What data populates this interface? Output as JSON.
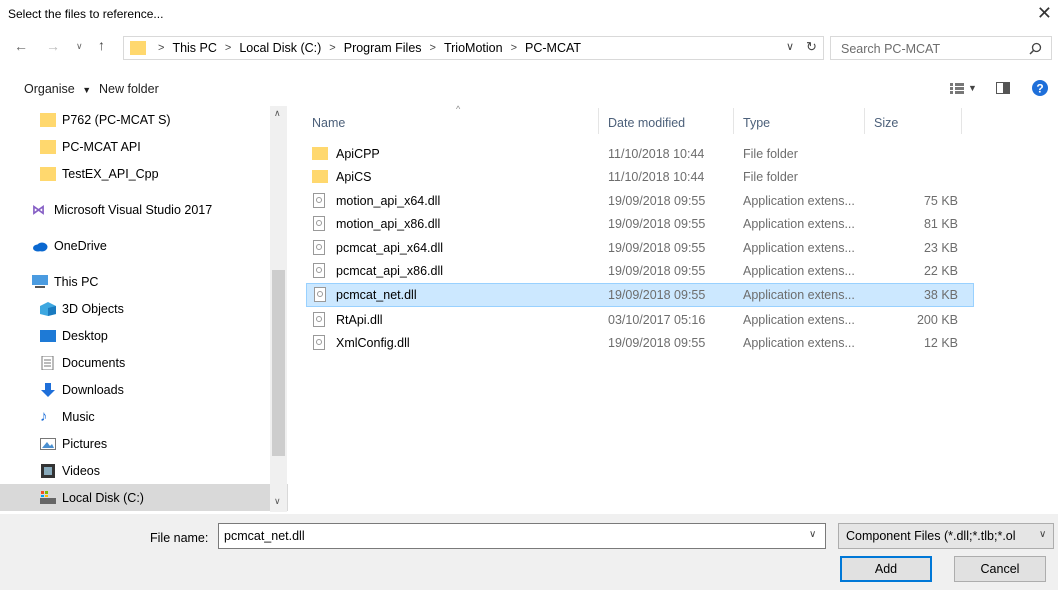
{
  "window": {
    "title": "Select the files to reference..."
  },
  "address": {
    "crumbs": [
      "This PC",
      "Local Disk (C:)",
      "Program Files",
      "TrioMotion",
      "PC-MCAT"
    ]
  },
  "search": {
    "placeholder": "Search PC-MCAT"
  },
  "toolbar": {
    "organise": "Organise",
    "new_folder": "New folder"
  },
  "navpane": {
    "items": [
      {
        "label": "P762 (PC-MCAT S)",
        "icon": "folder-icon"
      },
      {
        "label": "PC-MCAT API",
        "icon": "folder-icon"
      },
      {
        "label": "TestEX_API_Cpp",
        "icon": "folder-icon"
      },
      {
        "label": "Microsoft Visual Studio 2017",
        "icon": "visual-studio-icon"
      },
      {
        "label": "OneDrive",
        "icon": "onedrive-icon"
      },
      {
        "label": "This PC",
        "icon": "computer-icon"
      },
      {
        "label": "3D Objects",
        "icon": "3d-objects-icon"
      },
      {
        "label": "Desktop",
        "icon": "desktop-icon"
      },
      {
        "label": "Documents",
        "icon": "documents-icon"
      },
      {
        "label": "Downloads",
        "icon": "downloads-icon"
      },
      {
        "label": "Music",
        "icon": "music-icon"
      },
      {
        "label": "Pictures",
        "icon": "pictures-icon"
      },
      {
        "label": "Videos",
        "icon": "videos-icon"
      },
      {
        "label": "Local Disk (C:)",
        "icon": "drive-icon"
      }
    ]
  },
  "list": {
    "columns": {
      "name": "Name",
      "date": "Date modified",
      "type": "Type",
      "size": "Size"
    },
    "rows": [
      {
        "name": "ApiCPP",
        "date": "11/10/2018 10:44",
        "type": "File folder",
        "size": "",
        "icon": "folder-icon"
      },
      {
        "name": "ApiCS",
        "date": "11/10/2018 10:44",
        "type": "File folder",
        "size": "",
        "icon": "folder-icon"
      },
      {
        "name": "motion_api_x64.dll",
        "date": "19/09/2018 09:55",
        "type": "Application extens...",
        "size": "75 KB",
        "icon": "dll-file-icon"
      },
      {
        "name": "motion_api_x86.dll",
        "date": "19/09/2018 09:55",
        "type": "Application extens...",
        "size": "81 KB",
        "icon": "dll-file-icon"
      },
      {
        "name": "pcmcat_api_x64.dll",
        "date": "19/09/2018 09:55",
        "type": "Application extens...",
        "size": "23 KB",
        "icon": "dll-file-icon"
      },
      {
        "name": "pcmcat_api_x86.dll",
        "date": "19/09/2018 09:55",
        "type": "Application extens...",
        "size": "22 KB",
        "icon": "dll-file-icon"
      },
      {
        "name": "pcmcat_net.dll",
        "date": "19/09/2018 09:55",
        "type": "Application extens...",
        "size": "38 KB",
        "icon": "dll-file-icon"
      },
      {
        "name": "RtApi.dll",
        "date": "03/10/2017 05:16",
        "type": "Application extens...",
        "size": "200 KB",
        "icon": "dll-file-icon"
      },
      {
        "name": "XmlConfig.dll",
        "date": "19/09/2018 09:55",
        "type": "Application extens...",
        "size": "12 KB",
        "icon": "dll-file-icon"
      }
    ]
  },
  "filename": {
    "label": "File name:",
    "value": "pcmcat_net.dll"
  },
  "filter": {
    "value": "Component Files (*.dll;*.tlb;*.ol"
  },
  "buttons": {
    "add": "Add",
    "cancel": "Cancel"
  },
  "colors": {
    "accent": "#0078d7",
    "selection": "#cce8ff",
    "folder": "#ffd86e",
    "help": "#1e6fd9"
  }
}
